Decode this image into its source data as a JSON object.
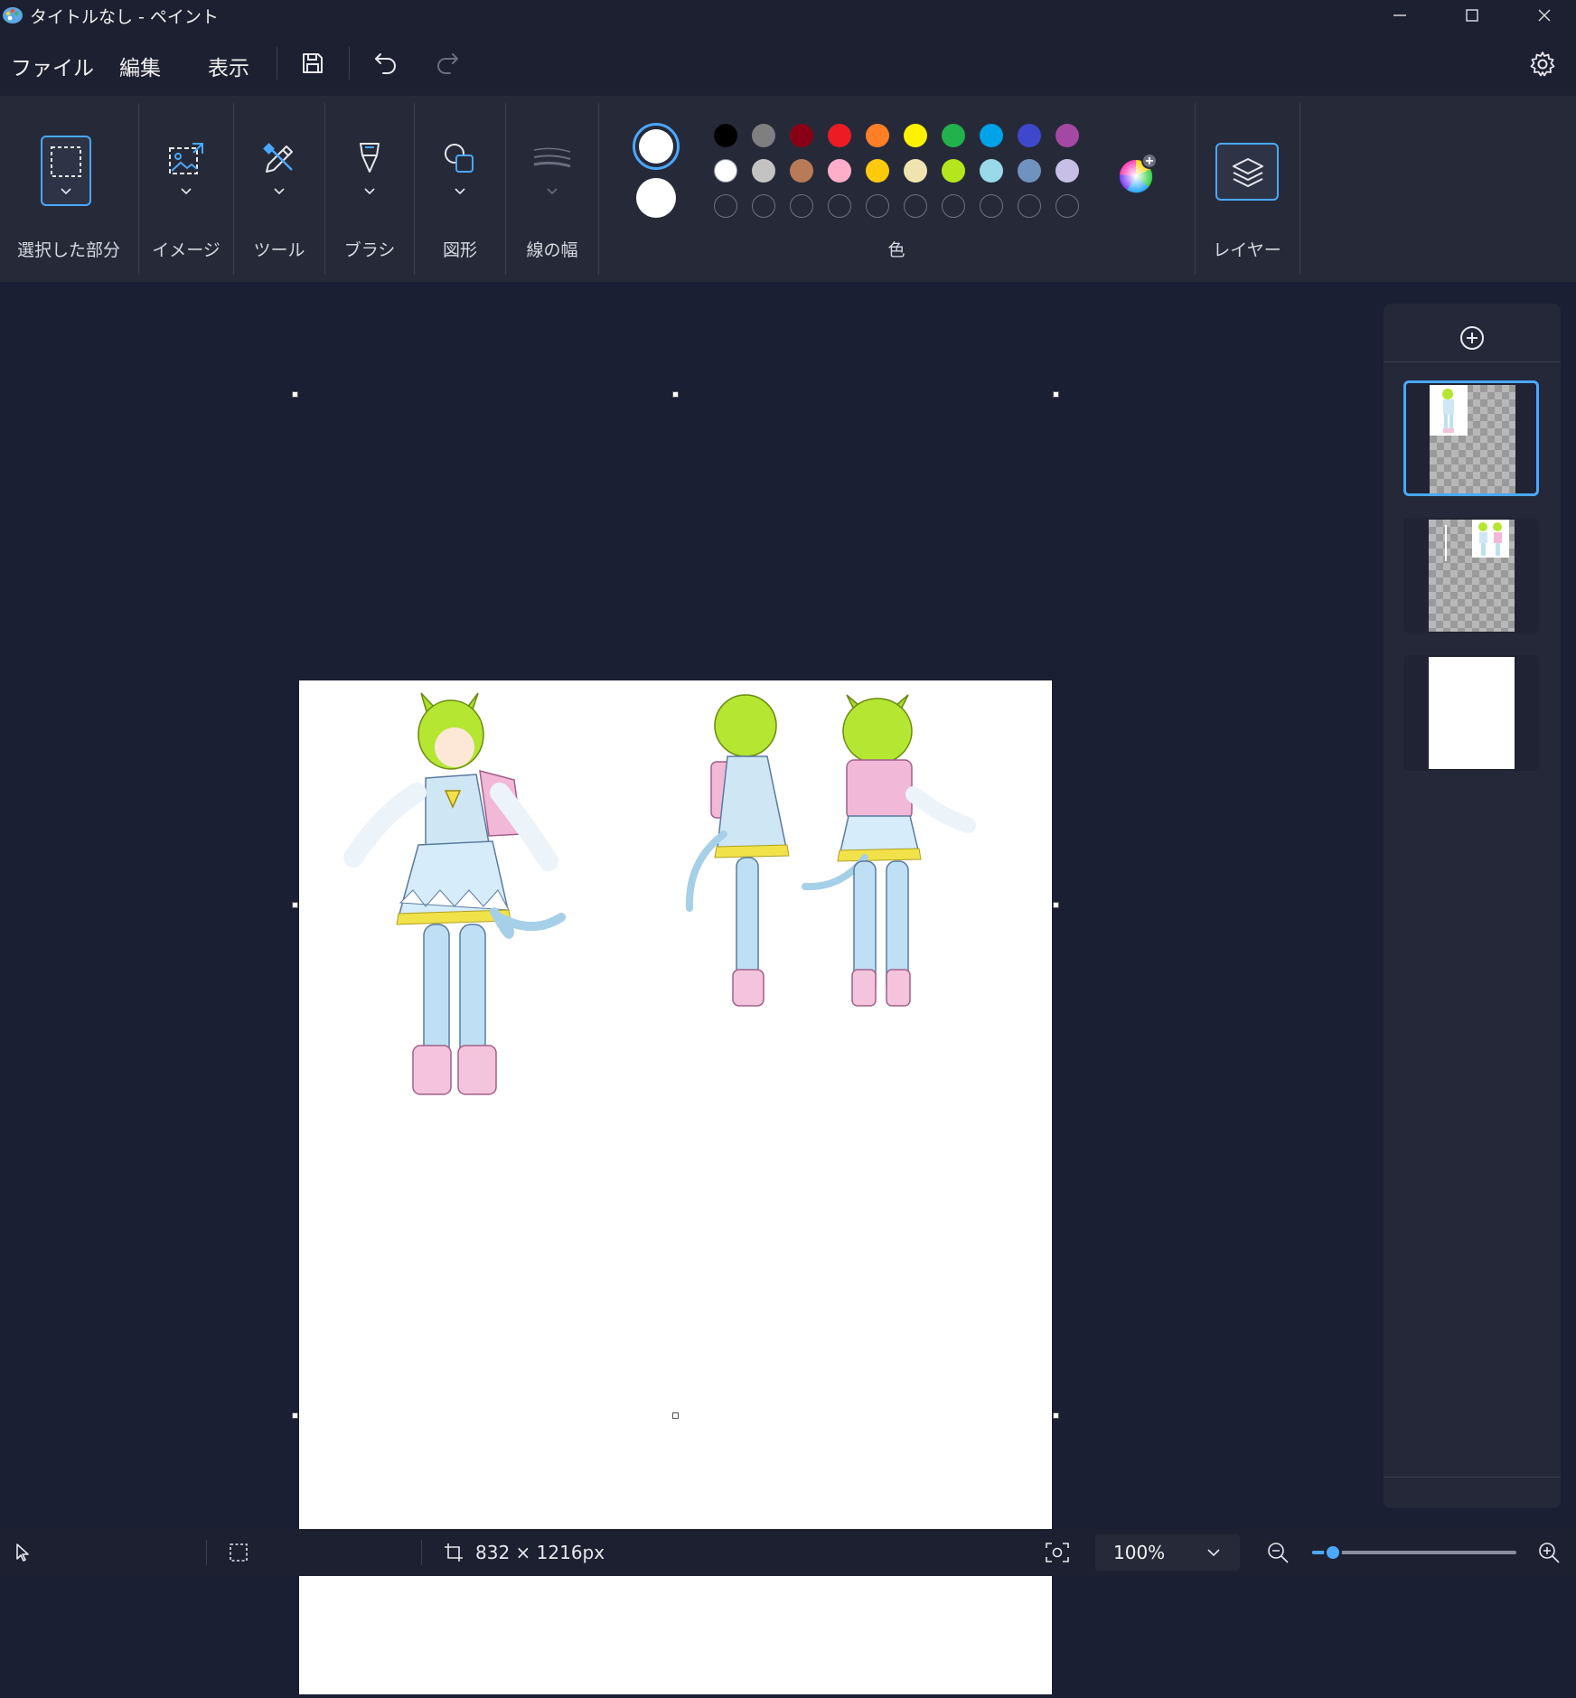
{
  "window": {
    "title": "タイトルなし - ペイント"
  },
  "menu": {
    "file": "ファイル",
    "edit": "編集",
    "view": "表示"
  },
  "toolbar": {
    "selection": "選択した部分",
    "image": "イメージ",
    "tools": "ツール",
    "brushes": "ブラシ",
    "shapes": "図形",
    "size": "線の幅",
    "colors": "色",
    "layers": "レイヤー"
  },
  "colors": {
    "primary": "#ffffff",
    "secondary": "#ffffff",
    "row1": [
      "#000000",
      "#7f7f7f",
      "#880015",
      "#ed1c24",
      "#ff7f27",
      "#fff200",
      "#22b14c",
      "#00a2e8",
      "#3f48cc",
      "#a349a4"
    ],
    "row2": [
      "#ffffff",
      "#c3c3c3",
      "#b97a57",
      "#ffaec9",
      "#ffc90e",
      "#efe4b0",
      "#b5e61d",
      "#99d9ea",
      "#7092be",
      "#c8bfe7"
    ],
    "custom_slots": 10,
    "accent": "#4aa8ff"
  },
  "layers": {
    "count": 3,
    "active_index": 0
  },
  "status": {
    "canvas_size": "832 × 1216px",
    "zoom": "100%",
    "zoom_fraction": 0.1
  }
}
